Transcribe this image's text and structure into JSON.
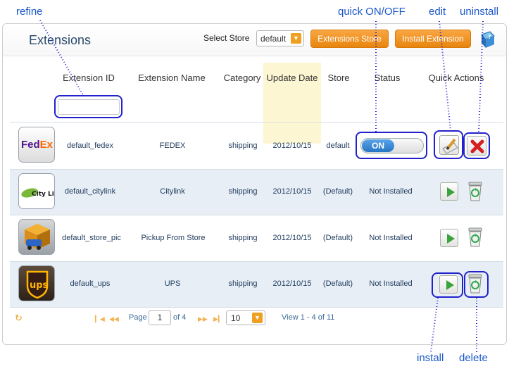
{
  "annotations": {
    "refine": "refine",
    "quick_onoff": "quick ON/OFF",
    "edit": "edit",
    "uninstall": "uninstall",
    "install": "install",
    "delete": "delete"
  },
  "header": {
    "title": "Extensions",
    "select_store_label": "Select Store",
    "store_value": "default",
    "extensions_store_button": "Extensions Store",
    "install_extension_button": "Install Extension",
    "help_icon": "help-book-icon"
  },
  "table": {
    "columns": [
      "Extension ID",
      "Extension Name",
      "Category",
      "Update Date",
      "Store",
      "Status",
      "Quick Actions"
    ],
    "filter_value": "",
    "rows": [
      {
        "logo": "FedEx",
        "id": "default_fedex",
        "name": "FEDEX",
        "category": "shipping",
        "date": "2012/10/15",
        "store": "default",
        "status": "ON"
      },
      {
        "logo": "City Link",
        "id": "default_citylink",
        "name": "Citylink",
        "category": "shipping",
        "date": "2012/10/15",
        "store": "(Default)",
        "status": "Not Installed"
      },
      {
        "logo": "store-pickup-icon",
        "id": "default_store_pic",
        "name": "Pickup From Store",
        "category": "shipping",
        "date": "2012/10/15",
        "store": "(Default)",
        "status": "Not Installed"
      },
      {
        "logo": "UPS",
        "id": "default_ups",
        "name": "UPS",
        "category": "shipping",
        "date": "2012/10/15",
        "store": "(Default)",
        "status": "Not Installed"
      }
    ]
  },
  "pager": {
    "page_label": "Page",
    "page_value": "1",
    "of_label": "of 4",
    "rows_value": "10",
    "summary": "View 1 - 4 of 11"
  },
  "colors": {
    "accent_orange": "#e8850e",
    "annotation_blue": "#1a57c9",
    "highlight_border": "#2222cc",
    "toggle_on": "#2676c6"
  }
}
